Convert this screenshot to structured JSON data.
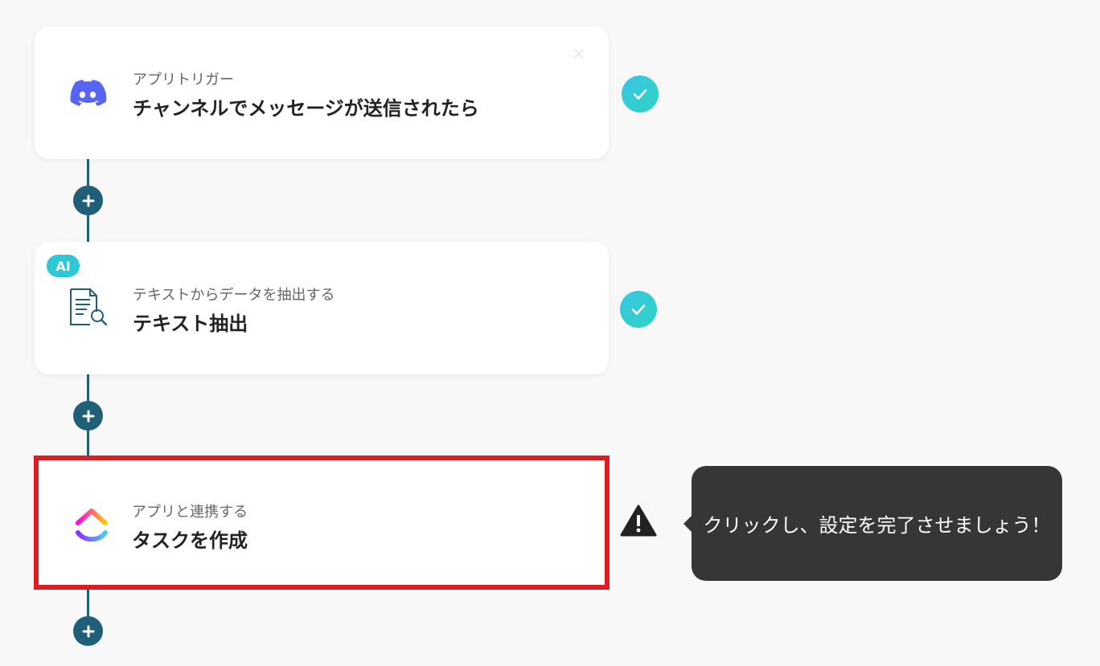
{
  "steps": [
    {
      "subtitle": "アプリトリガー",
      "title": "チャンネルでメッセージが送信されたら",
      "icon": "discord-icon",
      "status": "completed",
      "close": "×"
    },
    {
      "badge": "AI",
      "subtitle": "テキストからデータを抽出する",
      "title": "テキスト抽出",
      "icon": "document-search-icon",
      "status": "completed"
    },
    {
      "subtitle": "アプリと連携する",
      "title": "タスクを作成",
      "icon": "clickup-icon",
      "status": "warning"
    }
  ],
  "tooltip": {
    "text": "クリックし、設定を完了させましょう！"
  },
  "colors": {
    "connector": "#1f5f78",
    "highlight": "#e11b22",
    "check": "#2ec7d6",
    "tooltip_bg": "#363636"
  }
}
